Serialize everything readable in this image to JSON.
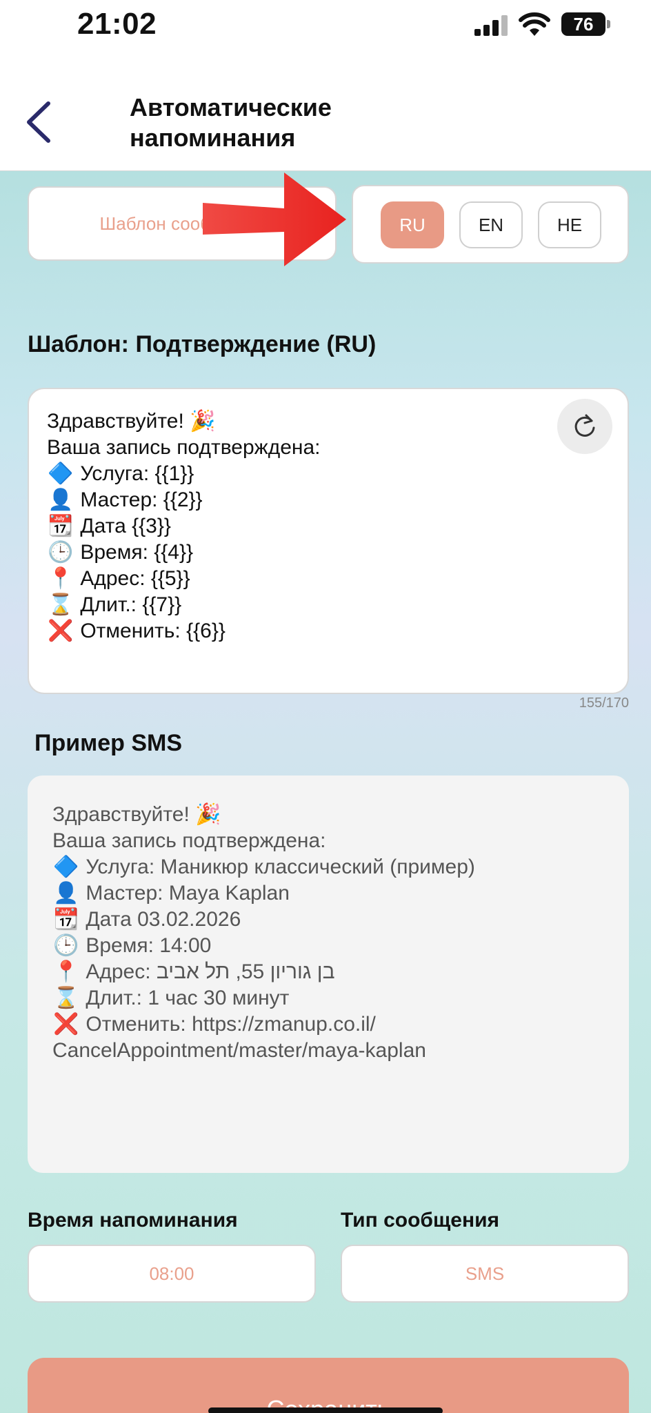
{
  "status_bar": {
    "time": "21:02",
    "battery": "76"
  },
  "header": {
    "title_line1": "Автоматические",
    "title_line2": "напоминания"
  },
  "template_select": {
    "placeholder": "Шаблон сообщения"
  },
  "languages": [
    {
      "label": "RU",
      "active": true
    },
    {
      "label": "EN",
      "active": false
    },
    {
      "label": "HE",
      "active": false
    }
  ],
  "template": {
    "title": "Шаблон: Подтверждение (RU)",
    "lines": [
      {
        "emoji": "",
        "text": "Здравствуйте! 🎉"
      },
      {
        "emoji": "",
        "text": "Ваша запись подтверждена:"
      },
      {
        "emoji": "🔷",
        "text": "Услуга: {{1}}"
      },
      {
        "emoji": "👤",
        "text": "Мастер: {{2}}"
      },
      {
        "emoji": "📆",
        "text": "Дата {{3}}"
      },
      {
        "emoji": "🕒",
        "text": "Время: {{4}}"
      },
      {
        "emoji": "📍",
        "text": "Адрес: {{5}}"
      },
      {
        "emoji": "⌛",
        "text": "Длит.: {{7}}"
      },
      {
        "emoji": "❌",
        "text": "Отменить: {{6}}"
      }
    ],
    "counter": "155/170"
  },
  "sms_example": {
    "title": "Пример SMS",
    "lines": [
      {
        "emoji": "",
        "text": "Здравствуйте! 🎉"
      },
      {
        "emoji": "",
        "text": "Ваша запись подтверждена:"
      },
      {
        "emoji": "🔷",
        "text": "Услуга: Маникюр классический (пример)"
      },
      {
        "emoji": "👤",
        "text": "Мастер: Maya Kaplan"
      },
      {
        "emoji": "📆",
        "text": "Дата 03.02.2026"
      },
      {
        "emoji": "🕒",
        "text": "Время: 14:00"
      },
      {
        "emoji": "📍",
        "text": "Адрес: בן גוריון 55, תל אביב"
      },
      {
        "emoji": "⌛",
        "text": "Длит.: 1 час 30 минут"
      },
      {
        "emoji": "❌",
        "text": "Отменить: https://zmanup.co.il/"
      },
      {
        "emoji": "",
        "text": "CancelAppointment/master/maya-kaplan"
      }
    ]
  },
  "reminder_time": {
    "label": "Время напоминания",
    "value": "08:00"
  },
  "message_type": {
    "label": "Тип сообщения",
    "value": "SMS"
  },
  "save_button": "Сохранить",
  "colors": {
    "accent": "#e89a85",
    "placeholder": "#e9a08c",
    "arrow": "#ee2f2f"
  }
}
